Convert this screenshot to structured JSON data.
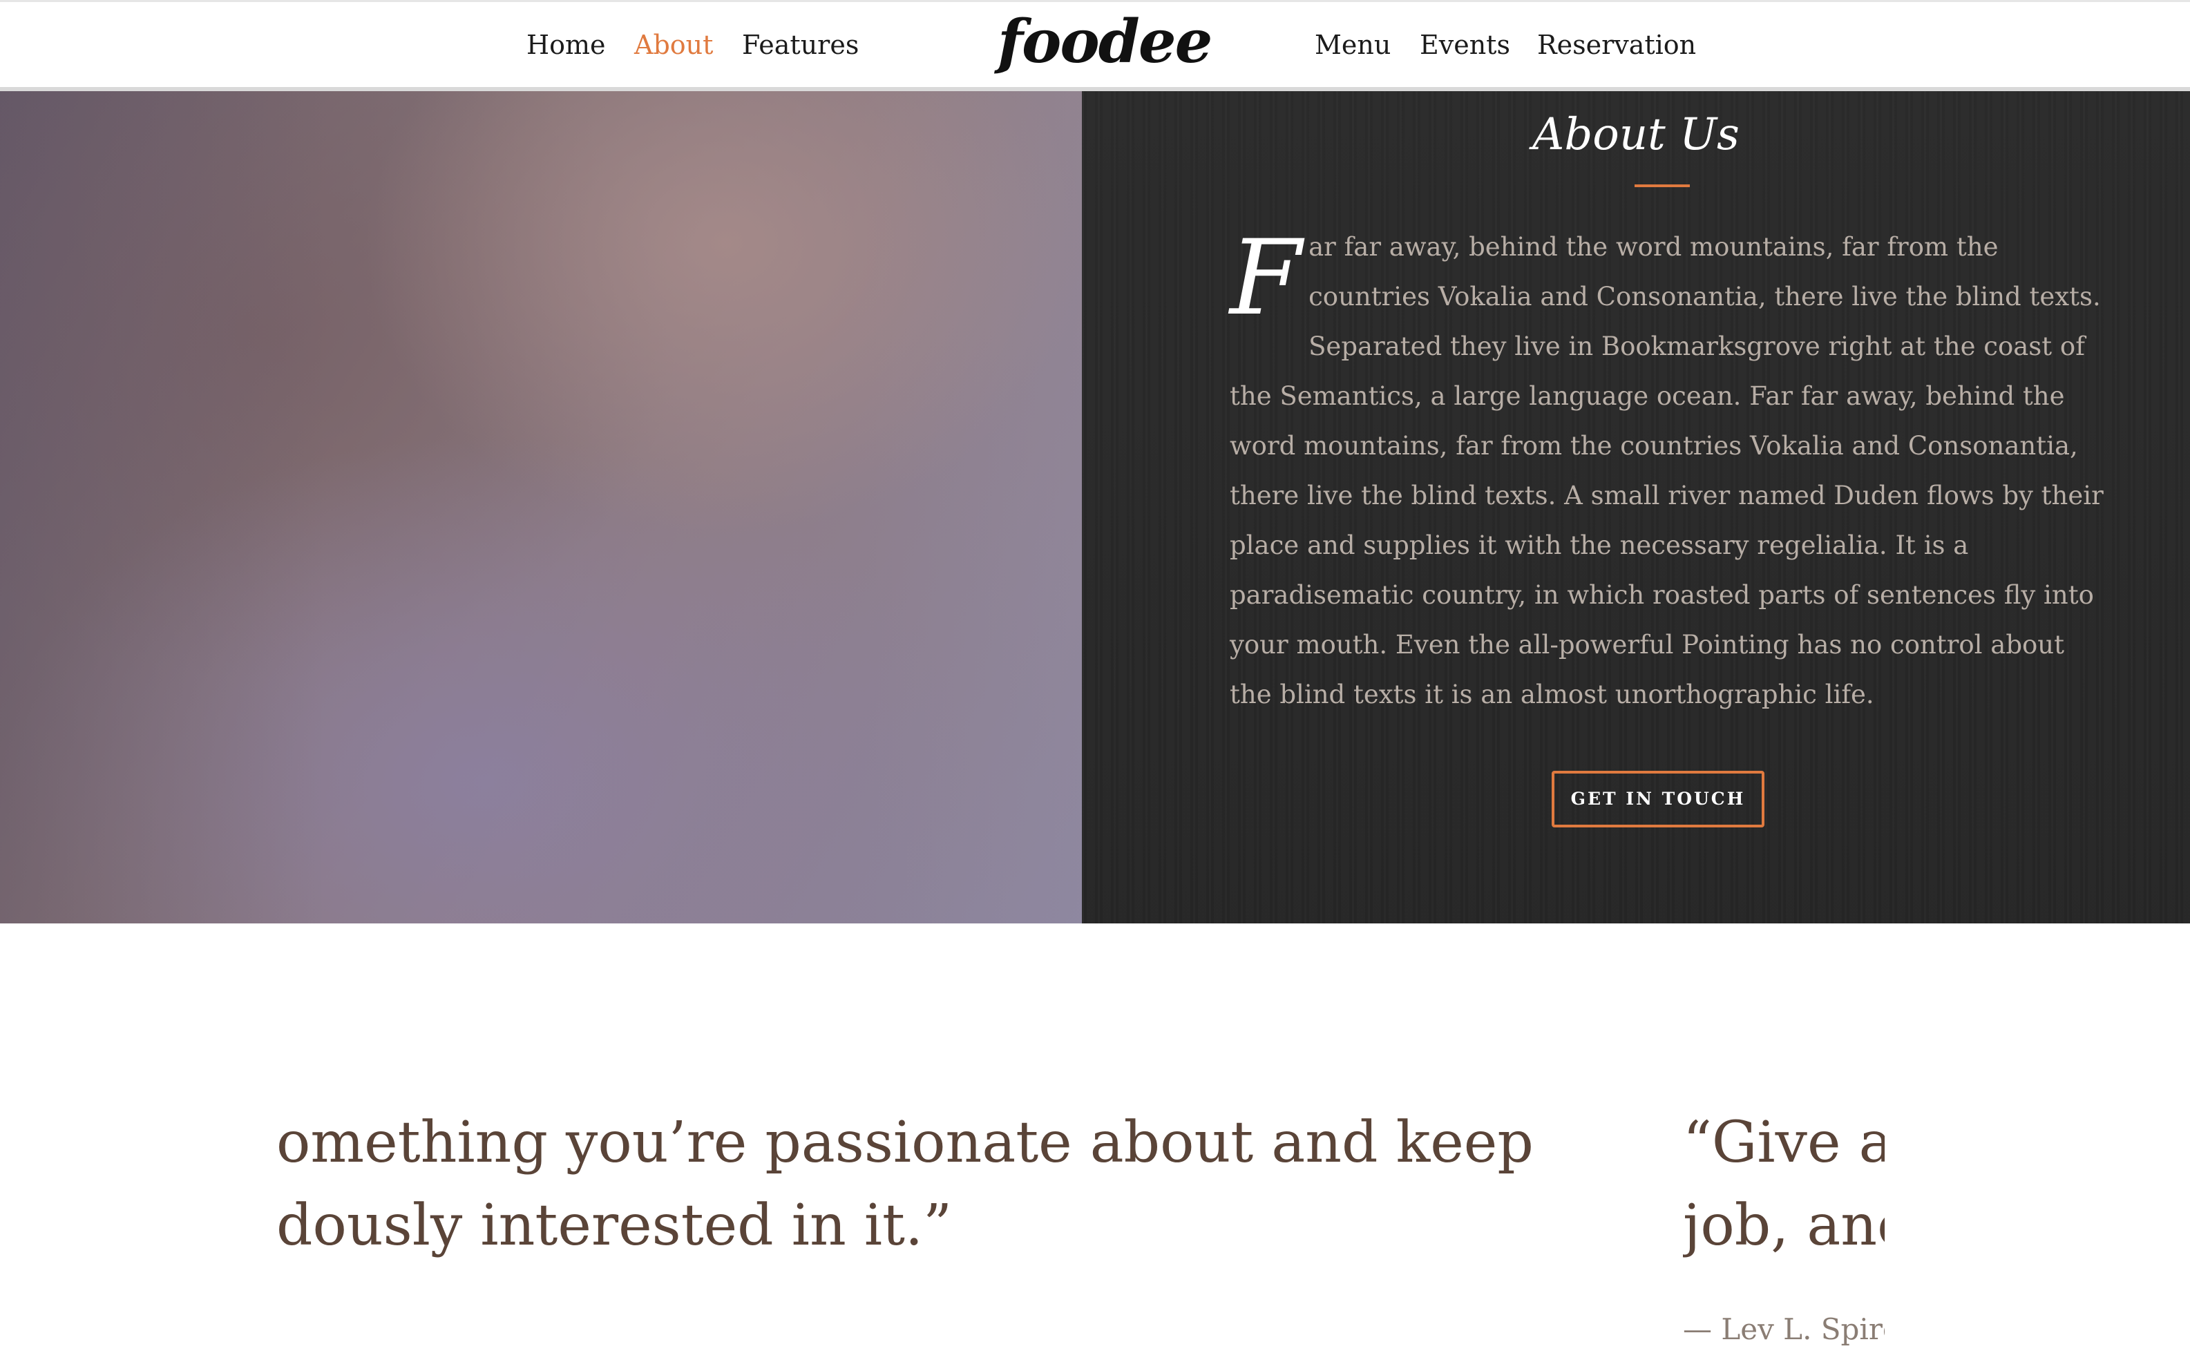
{
  "nav": {
    "left_items": [
      {
        "label": "Home",
        "active": false
      },
      {
        "label": "About",
        "active": true
      },
      {
        "label": "Features",
        "active": false
      }
    ],
    "brand": "foodee",
    "right_items": [
      {
        "label": "Menu",
        "active": false
      },
      {
        "label": "Events",
        "active": false
      },
      {
        "label": "Reservation",
        "active": false
      }
    ]
  },
  "about": {
    "title": "About Us",
    "dropcap": "F",
    "body": "ar far away, behind the word mountains, far from the countries Vokalia and Consonantia, there live the blind texts. Separated they live in Bookmarksgrove right at the coast of the Semantics, a large language ocean. Far far away, behind the word mountains, far from the countries Vokalia and Consonantia, there live the blind texts. A small river named Duden flows by their place and supplies it with the necessary regelialia. It is a paradisematic country, in which roasted parts of sentences fly into your mouth. Even the all-powerful Pointing has no control about the blind texts it is an almost unorthographic life.",
    "button_label": "GET IN TOUCH"
  },
  "testimonials": {
    "left_quote_line1": "omething you’re passionate about and keep",
    "left_quote_line2": "dously interested in it.”",
    "right_quote_line1": "“Give a",
    "right_quote_line2": "job, anc",
    "right_author": "— Lev L. Spiro"
  },
  "colors": {
    "accent": "#e07a3f",
    "panel_dark": "#262626",
    "quote_text": "#5a4438",
    "body_text": "#b8aea6"
  }
}
